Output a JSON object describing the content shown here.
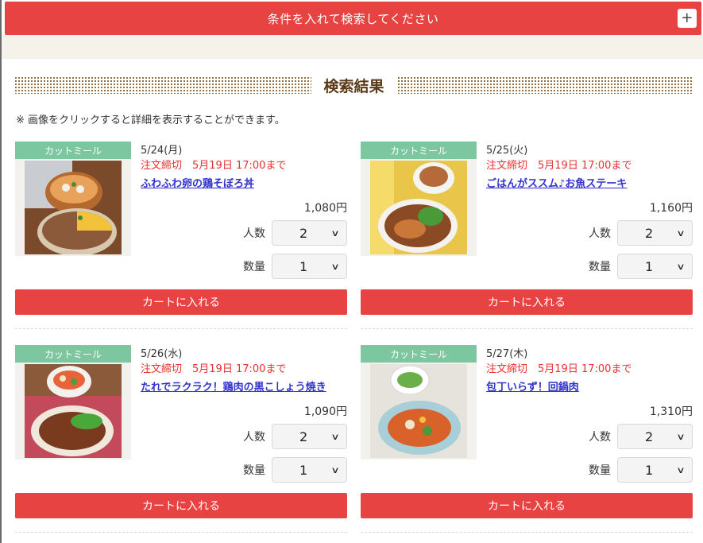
{
  "search": {
    "label": "条件を入れて検索してください",
    "expand_icon": "plus-icon",
    "expand_glyph": "+"
  },
  "results": {
    "heading": "検索結果",
    "note": "※ 画像をクリックすると詳細を表示することができます。"
  },
  "common": {
    "tag": "カットミール",
    "servings_label": "人数",
    "quantity_label": "数量",
    "cart_label": "カートに入れる"
  },
  "products": [
    {
      "date": "5/24(月)",
      "deadline": "注文締切　5月19日 17:00まで",
      "name": "ふわふわ卵の鶏そぼろ丼",
      "price": "1,080円",
      "servings": "2",
      "quantity": "1"
    },
    {
      "date": "5/25(火)",
      "deadline": "注文締切　5月19日 17:00まで",
      "name": "ごはんがススム♪お魚ステーキ",
      "price": "1,160円",
      "servings": "2",
      "quantity": "1"
    },
    {
      "date": "5/26(水)",
      "deadline": "注文締切　5月19日 17:00まで",
      "name": "たれでラクラク！鶏肉の黒こしょう焼き",
      "price": "1,090円",
      "servings": "2",
      "quantity": "1"
    },
    {
      "date": "5/27(木)",
      "deadline": "注文締切　5月19日 17:00まで",
      "name": "包丁いらず！回鍋肉",
      "price": "1,310円",
      "servings": "2",
      "quantity": "1"
    }
  ],
  "colors": {
    "accent_red": "#e84343",
    "tag_green": "#7dc7a0",
    "deadline_red": "#e83030",
    "link_blue": "#3333cc"
  }
}
